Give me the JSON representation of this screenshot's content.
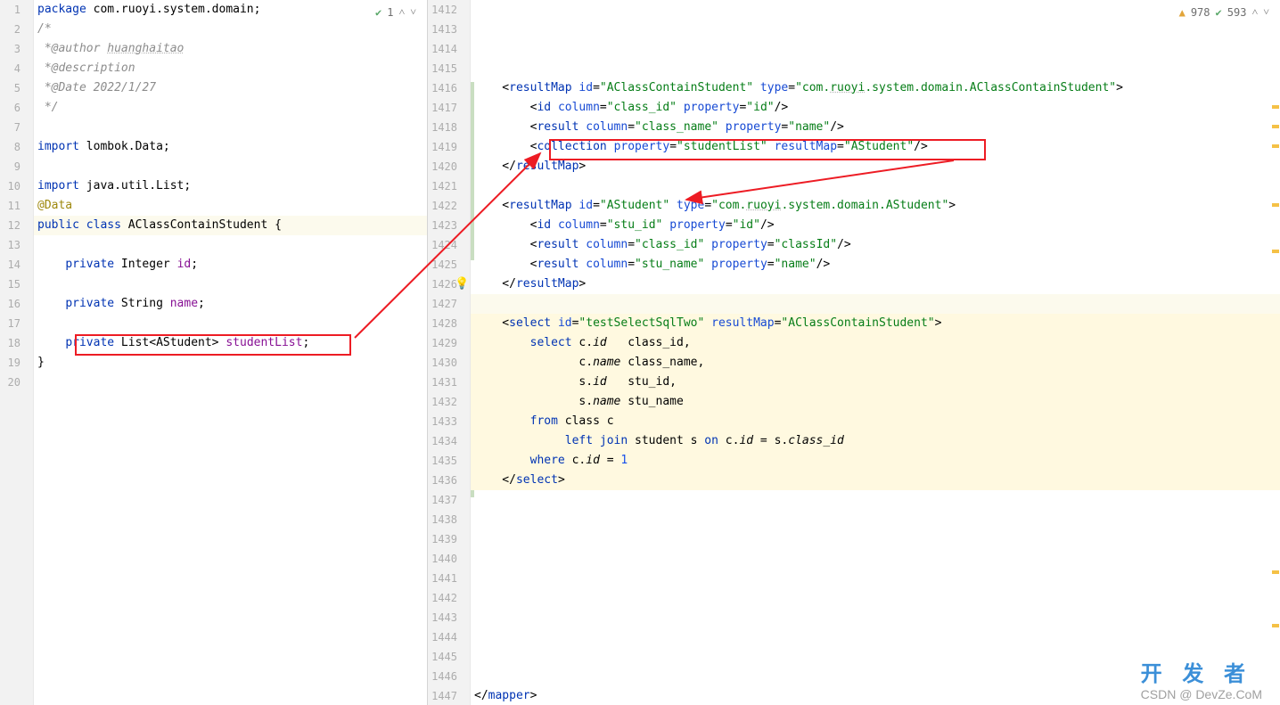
{
  "left": {
    "status": {
      "count": "1"
    },
    "gutter_start": 1,
    "lines": [
      {
        "n": 1,
        "html": "<span class='kw'>package</span> <span class='pkg'>com.ruoyi.system.domain</span>;"
      },
      {
        "n": 2,
        "html": "<span class='comment'>/*</span>"
      },
      {
        "n": 3,
        "html": "<span class='comment'> *@author <span class='under'>huanghaitao</span></span>"
      },
      {
        "n": 4,
        "html": "<span class='comment'> *@description</span>"
      },
      {
        "n": 5,
        "html": "<span class='comment'> *@Date 2022/1/27</span>"
      },
      {
        "n": 6,
        "html": "<span class='comment'> */</span>"
      },
      {
        "n": 7,
        "html": ""
      },
      {
        "n": 8,
        "html": "<span class='kw'>import</span> lombok.<span class='type'>Data</span>;"
      },
      {
        "n": 9,
        "html": ""
      },
      {
        "n": 10,
        "html": "<span class='kw'>import</span> java.util.List;"
      },
      {
        "n": 11,
        "html": "<span class='ann'>@Data</span>"
      },
      {
        "n": 12,
        "html": "<span class='kw'>public class</span> <span class='type'>AClassContainStudent</span> {",
        "hl": true
      },
      {
        "n": 13,
        "html": ""
      },
      {
        "n": 14,
        "html": "    <span class='kw'>private</span> Integer <span class='field'>id</span>;"
      },
      {
        "n": 15,
        "html": ""
      },
      {
        "n": 16,
        "html": "    <span class='kw'>private</span> String <span class='field'>name</span>;"
      },
      {
        "n": 17,
        "html": ""
      },
      {
        "n": 18,
        "html": "    <span class='kw'>private</span> List&lt;AStudent&gt; <span class='field'>studentList</span>;"
      },
      {
        "n": 19,
        "html": "}"
      },
      {
        "n": 20,
        "html": ""
      }
    ]
  },
  "right": {
    "status": {
      "warn": "978",
      "ok": "593"
    },
    "gutter_start": 1412,
    "lines": [
      {
        "n": 1412,
        "html": ""
      },
      {
        "n": 1413,
        "html": ""
      },
      {
        "n": 1414,
        "html": ""
      },
      {
        "n": 1415,
        "html": ""
      },
      {
        "n": 1416,
        "html": "    &lt;<span class='tag'>resultMap</span> <span class='attr'>id</span>=<span class='str'>\"AClassContainStudent\"</span> <span class='attr'>type</span>=<span class='str'>\"com.<span class='under'>ruoyi</span>.system.domain.AClassContainStudent\"</span>&gt;"
      },
      {
        "n": 1417,
        "html": "        &lt;<span class='tag'>id</span> <span class='attr'>column</span>=<span class='str'>\"class_id\"</span> <span class='attr'>property</span>=<span class='str'>\"id\"</span>/&gt;"
      },
      {
        "n": 1418,
        "html": "        &lt;<span class='tag'>result</span> <span class='attr'>column</span>=<span class='str'>\"class_name\"</span> <span class='attr'>property</span>=<span class='str'>\"name\"</span>/&gt;"
      },
      {
        "n": 1419,
        "html": "        &lt;<span class='tag'>collection</span> <span class='attr'>property</span>=<span class='str'>\"studentList\"</span> <span class='attr'>resultMap</span>=<span class='str'>\"AStudent\"</span>/&gt;"
      },
      {
        "n": 1420,
        "html": "    &lt;/<span class='tag'>resultMap</span>&gt;"
      },
      {
        "n": 1421,
        "html": ""
      },
      {
        "n": 1422,
        "html": "    &lt;<span class='tag'>resultMap</span> <span class='attr'>id</span>=<span class='str'>\"AStudent\"</span> <span class='attr'>type</span>=<span class='str'>\"com.<span class='under'>ruoyi</span>.system.domain.AStudent\"</span>&gt;"
      },
      {
        "n": 1423,
        "html": "        &lt;<span class='tag'>id</span> <span class='attr'>column</span>=<span class='str'>\"stu_id\"</span> <span class='attr'>property</span>=<span class='str'>\"id\"</span>/&gt;"
      },
      {
        "n": 1424,
        "html": "        &lt;<span class='tag'>result</span> <span class='attr'>column</span>=<span class='str'>\"class_id\"</span> <span class='attr'>property</span>=<span class='str'>\"classId\"</span>/&gt;"
      },
      {
        "n": 1425,
        "html": "        &lt;<span class='tag'>result</span> <span class='attr'>column</span>=<span class='str'>\"stu_name\"</span> <span class='attr'>property</span>=<span class='str'>\"name\"</span>/&gt;"
      },
      {
        "n": 1426,
        "html": "    &lt;/<span class='tag'>resultMap</span>&gt;",
        "bulb": true
      },
      {
        "n": 1427,
        "html": "",
        "hl": true
      },
      {
        "n": 1428,
        "html": "    &lt;<span class='tag'>select</span> <span class='attr'>id</span>=<span class='str'>\"testSelectSqlTwo\"</span> <span class='attr'>resultMap</span>=<span class='str'>\"AClassContainStudent\"</span>&gt;",
        "block": true
      },
      {
        "n": 1429,
        "html": "        <span class='kw'>select</span> c.<span class='ital'>id</span>   class_id,",
        "block": true
      },
      {
        "n": 1430,
        "html": "               c.<span class='ital'>name</span> class_name,",
        "block": true
      },
      {
        "n": 1431,
        "html": "               s.<span class='ital'>id</span>   stu_id,",
        "block": true
      },
      {
        "n": 1432,
        "html": "               s.<span class='ital'>name</span> stu_name",
        "block": true
      },
      {
        "n": 1433,
        "html": "        <span class='kw'>from</span> class c",
        "block": true
      },
      {
        "n": 1434,
        "html": "             <span class='kw'>left join</span> student s <span class='kw'>on</span> c.<span class='ital'>id</span> = s.<span class='ital'>class_id</span>",
        "block": true
      },
      {
        "n": 1435,
        "html": "        <span class='kw'>where</span> c.<span class='ital'>id</span> = <span class='num'>1</span>",
        "block": true
      },
      {
        "n": 1436,
        "html": "    &lt;/<span class='tag'>select</span>&gt;",
        "block": true
      },
      {
        "n": 1437,
        "html": ""
      },
      {
        "n": 1438,
        "html": ""
      },
      {
        "n": 1439,
        "html": ""
      },
      {
        "n": 1440,
        "html": ""
      },
      {
        "n": 1441,
        "html": ""
      },
      {
        "n": 1442,
        "html": ""
      },
      {
        "n": 1443,
        "html": ""
      },
      {
        "n": 1444,
        "html": ""
      },
      {
        "n": 1445,
        "html": ""
      },
      {
        "n": 1446,
        "html": ""
      },
      {
        "n": 1447,
        "html": "&lt;/<span class='tag'>mapper</span>&gt;"
      }
    ]
  },
  "watermark": {
    "top": "开 发 者",
    "bottom": "CSDN @ DevZe.CoM"
  }
}
